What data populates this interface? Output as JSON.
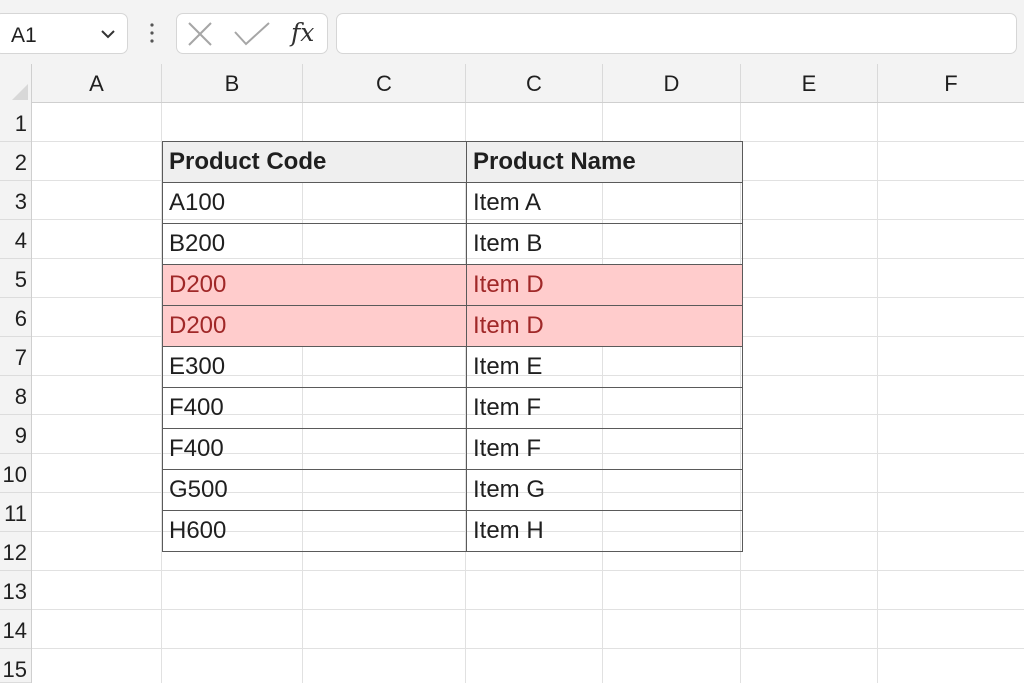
{
  "name_box": {
    "value": "A1"
  },
  "formula_bar": {
    "value": ""
  },
  "column_headers": [
    "A",
    "B",
    "C",
    "C",
    "D",
    "E",
    "F"
  ],
  "row_headers": [
    "1",
    "2",
    "3",
    "4",
    "5",
    "6",
    "7",
    "8",
    "9",
    "10",
    "11",
    "12",
    "13",
    "14",
    "15"
  ],
  "table": {
    "headers": [
      "Product Code",
      "Product Name"
    ],
    "rows": [
      {
        "code": "A100",
        "name": "Item A",
        "duplicate": false
      },
      {
        "code": "B200",
        "name": "Item B",
        "duplicate": false
      },
      {
        "code": "D200",
        "name": "Item D",
        "duplicate": true
      },
      {
        "code": "D200",
        "name": "Item D",
        "duplicate": true
      },
      {
        "code": "E300",
        "name": "Item E",
        "duplicate": false
      },
      {
        "code": "F400",
        "name": "Item F",
        "duplicate": false
      },
      {
        "code": "F400",
        "name": "Item F",
        "duplicate": false
      },
      {
        "code": "G500",
        "name": "Item G",
        "duplicate": false
      },
      {
        "code": "H600",
        "name": "Item H",
        "duplicate": false
      }
    ]
  },
  "colors": {
    "duplicate_fill": "#ffcccc",
    "duplicate_text": "#a02828",
    "header_fill": "#efefef",
    "chrome_bg": "#f3f3f3"
  },
  "icons": {
    "name_box_dropdown": "chevron-down-icon",
    "more": "vertical-dots-icon",
    "cancel": "cancel-x-icon",
    "enter": "enter-check-icon",
    "insert_function": "fx-icon"
  }
}
